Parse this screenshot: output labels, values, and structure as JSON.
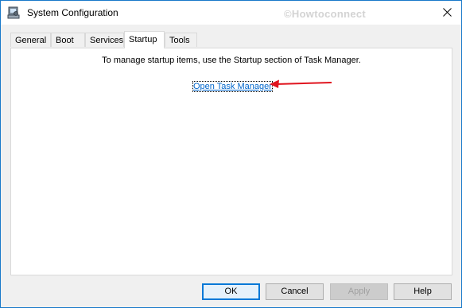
{
  "window": {
    "title": "System Configuration",
    "watermark": "©Howtoconnect",
    "close_glyph": "✕"
  },
  "tabs": [
    {
      "label": "General"
    },
    {
      "label": "Boot"
    },
    {
      "label": "Services"
    },
    {
      "label": "Startup",
      "selected": true
    },
    {
      "label": "Tools"
    }
  ],
  "startup": {
    "message": "To manage startup items, use the Startup section of Task Manager.",
    "link_label": "Open Task Manager",
    "annotation_color": "#e0141e"
  },
  "buttons": {
    "ok": "OK",
    "cancel": "Cancel",
    "apply": "Apply",
    "help": "Help"
  }
}
